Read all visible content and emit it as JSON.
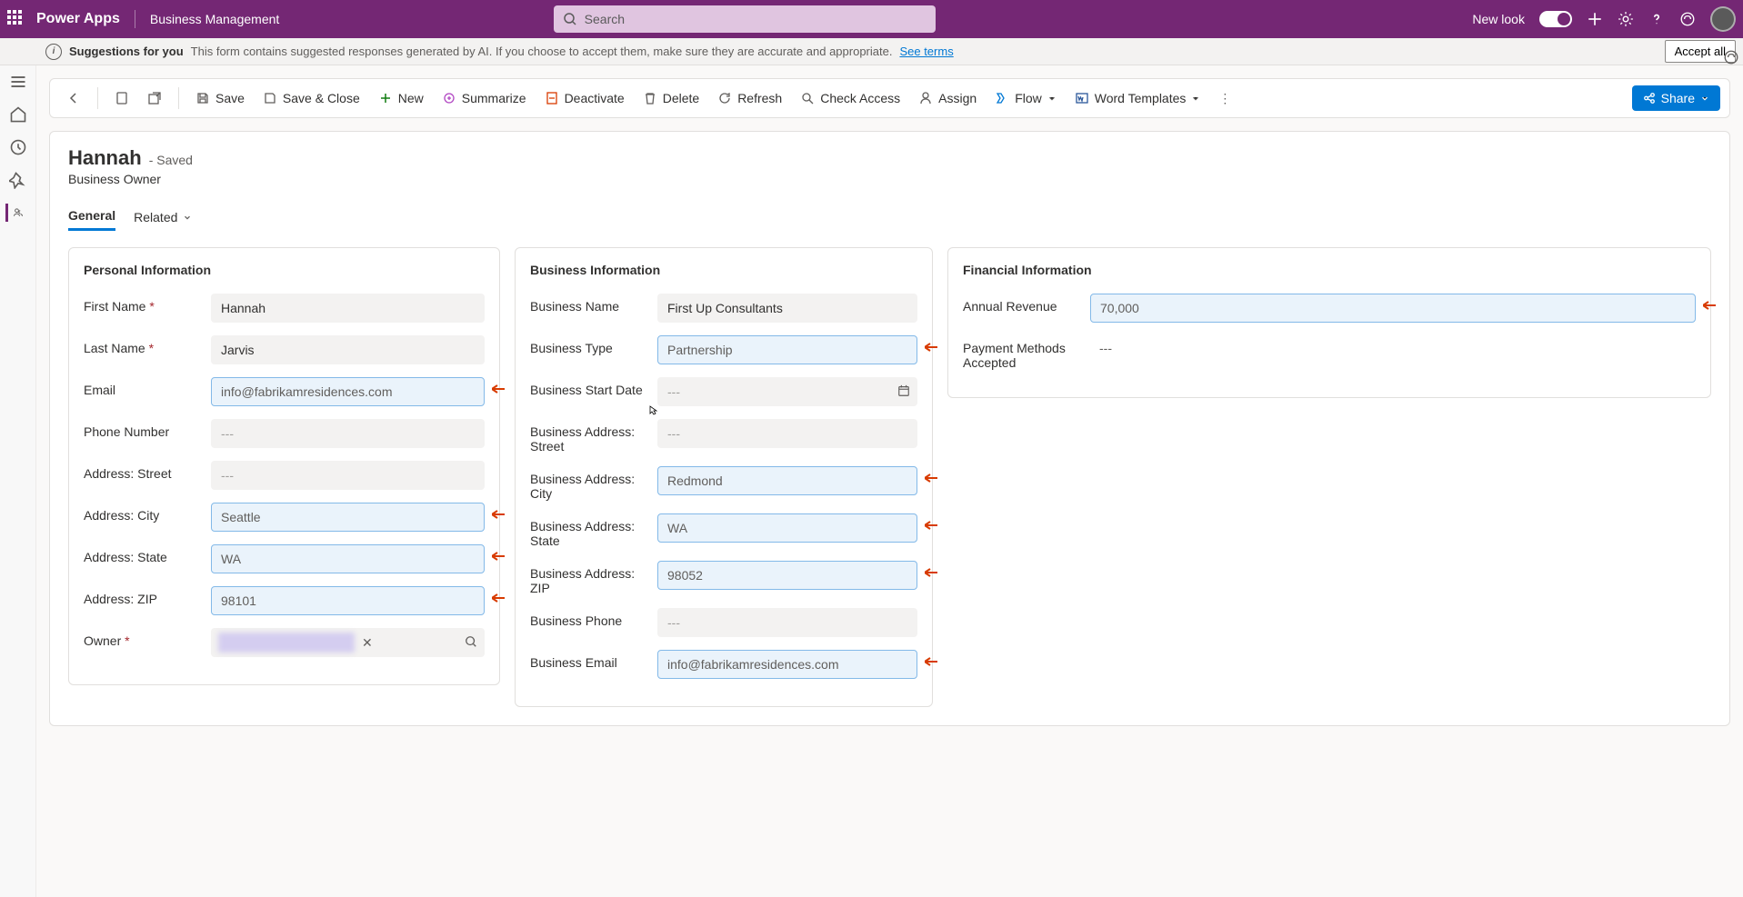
{
  "header": {
    "brand": "Power Apps",
    "app": "Business Management",
    "search_placeholder": "Search",
    "new_look": "New look"
  },
  "suggestion": {
    "title": "Suggestions for you",
    "text": "This form contains suggested responses generated by AI. If you choose to accept them, make sure they are accurate and appropriate.",
    "link": "See terms",
    "accept": "Accept all"
  },
  "commands": {
    "save": "Save",
    "save_close": "Save & Close",
    "new": "New",
    "summarize": "Summarize",
    "deactivate": "Deactivate",
    "delete": "Delete",
    "refresh": "Refresh",
    "check_access": "Check Access",
    "assign": "Assign",
    "flow": "Flow",
    "word": "Word Templates",
    "share": "Share"
  },
  "record": {
    "title": "Hannah",
    "status": "- Saved",
    "entity": "Business Owner"
  },
  "tabs": {
    "general": "General",
    "related": "Related"
  },
  "sections": {
    "personal": {
      "title": "Personal Information",
      "fields": {
        "first_name": {
          "label": "First Name",
          "value": "Hannah",
          "required": true
        },
        "last_name": {
          "label": "Last Name",
          "value": "Jarvis",
          "required": true
        },
        "email": {
          "label": "Email",
          "value": "info@fabrikamresidences.com",
          "suggested": true
        },
        "phone": {
          "label": "Phone Number",
          "value": "---"
        },
        "street": {
          "label": "Address: Street",
          "value": "---"
        },
        "city": {
          "label": "Address: City",
          "value": "Seattle",
          "suggested": true
        },
        "state": {
          "label": "Address: State",
          "value": "WA",
          "suggested": true
        },
        "zip": {
          "label": "Address: ZIP",
          "value": "98101",
          "suggested": true
        },
        "owner": {
          "label": "Owner",
          "required": true
        }
      }
    },
    "business": {
      "title": "Business Information",
      "fields": {
        "name": {
          "label": "Business Name",
          "value": "First Up Consultants"
        },
        "type": {
          "label": "Business Type",
          "value": "Partnership",
          "suggested": true
        },
        "start_date": {
          "label": "Business Start Date",
          "value": "---"
        },
        "street": {
          "label": "Business Address: Street",
          "value": "---"
        },
        "city": {
          "label": "Business Address: City",
          "value": "Redmond",
          "suggested": true
        },
        "state": {
          "label": "Business Address: State",
          "value": "WA",
          "suggested": true
        },
        "zip": {
          "label": "Business Address: ZIP",
          "value": "98052",
          "suggested": true
        },
        "phone": {
          "label": "Business Phone",
          "value": "---"
        },
        "email": {
          "label": "Business Email",
          "value": "info@fabrikamresidences.com",
          "suggested": true
        }
      }
    },
    "financial": {
      "title": "Financial Information",
      "fields": {
        "revenue": {
          "label": "Annual Revenue",
          "value": "70,000",
          "suggested": true
        },
        "payment": {
          "label": "Payment Methods Accepted",
          "value": "---"
        }
      }
    }
  }
}
